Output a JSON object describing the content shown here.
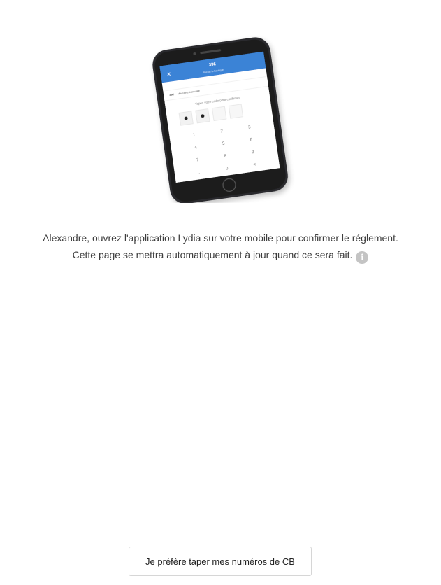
{
  "illustration": {
    "phone_header_amount": "39€",
    "phone_header_subtitle": "Rue de la Boutique",
    "phone_account_label": "39€",
    "phone_account_text": "Ma carte bancaire",
    "phone_prompt": "Tapez votre code pour confirmer",
    "keypad": [
      "1",
      "2",
      "3",
      "4",
      "5",
      "6",
      "7",
      "8",
      "9",
      ".",
      "0",
      "<"
    ],
    "accent_color": "#3a83d6"
  },
  "instructions": {
    "line1": "Alexandre, ouvrez l'application Lydia sur votre mobile pour confirmer le réglement.",
    "line2": "Cette page se mettra automatiquement à jour quand ce sera fait.",
    "info_icon": "info-circle-icon",
    "info_glyph": "i"
  },
  "actions": {
    "card_button_label": "Je préfère taper mes numéros de CB"
  }
}
